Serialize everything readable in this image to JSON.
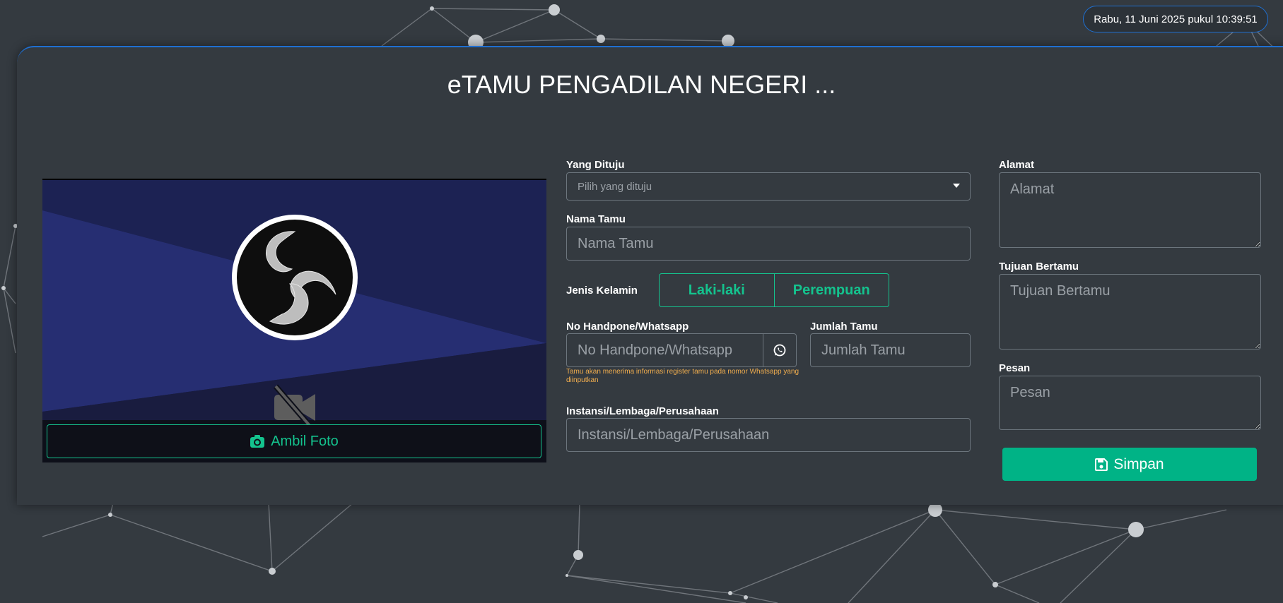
{
  "header": {
    "datetime": "Rabu, 11 Juni 2025 pukul 10:39:51"
  },
  "page": {
    "title": "eTAMU PENGADILAN NEGERI ..."
  },
  "camera": {
    "take_photo_label": "Ambil Foto",
    "take_photo_icon": "camera-icon",
    "logo_icon": "obs-logo-icon",
    "status_icon": "video-off-icon"
  },
  "form": {
    "yang_dituju": {
      "label": "Yang Dituju",
      "placeholder": "Pilih yang dituju"
    },
    "nama_tamu": {
      "label": "Nama Tamu",
      "placeholder": "Nama Tamu"
    },
    "jenis_kelamin": {
      "label": "Jenis Kelamin",
      "options": [
        "Laki-laki",
        "Perempuan"
      ]
    },
    "no_hp": {
      "label": "No Handpone/Whatsapp",
      "placeholder": "No Handpone/Whatsapp",
      "addon_icon": "whatsapp-icon",
      "hint": "Tamu akan menerima informasi register tamu pada nomor Whatsapp yang diinputkan"
    },
    "jumlah_tamu": {
      "label": "Jumlah Tamu",
      "placeholder": "Jumlah Tamu"
    },
    "instansi": {
      "label": "Instansi/Lembaga/Perusahaan",
      "placeholder": "Instansi/Lembaga/Perusahaan"
    },
    "alamat": {
      "label": "Alamat",
      "placeholder": "Alamat"
    },
    "tujuan": {
      "label": "Tujuan Bertamu",
      "placeholder": "Tujuan Bertamu"
    },
    "pesan": {
      "label": "Pesan",
      "placeholder": "Pesan"
    }
  },
  "actions": {
    "simpan_label": "Simpan",
    "simpan_icon": "floppy-disk-icon"
  },
  "colors": {
    "background": "#343a40",
    "accent_blue": "#1f6fd1",
    "accent_green": "#14c38e",
    "button_green": "#00b386",
    "hint_orange": "#f0ad4e"
  }
}
